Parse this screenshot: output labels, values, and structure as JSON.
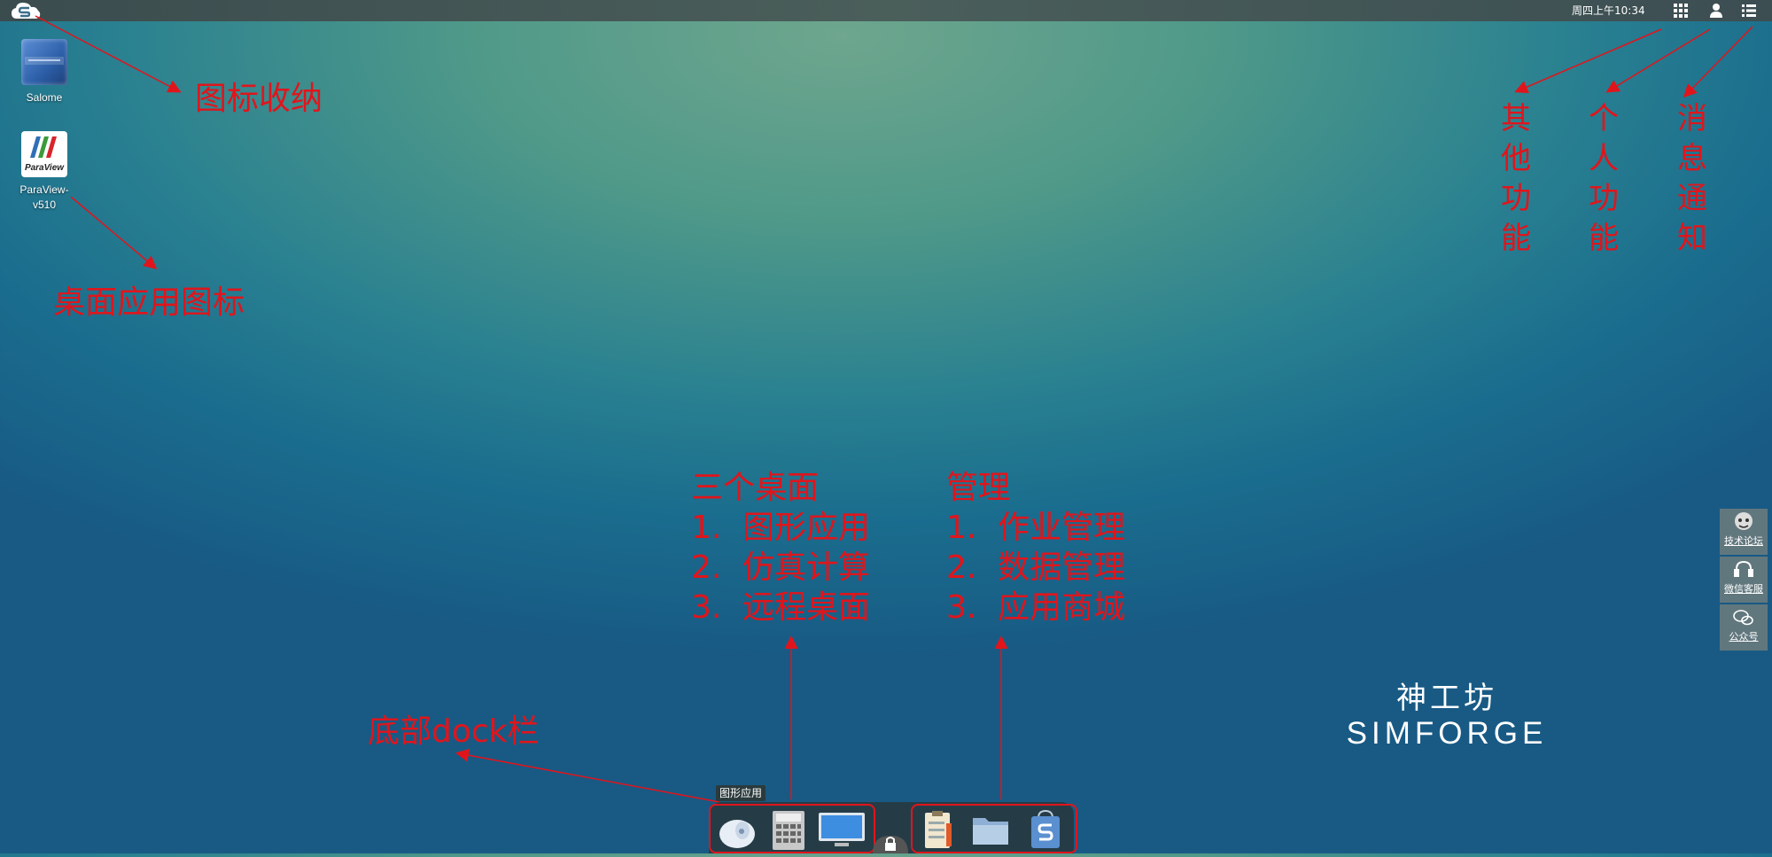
{
  "topbar": {
    "clock": "周四上午10:34",
    "icons": [
      "apps-grid-icon",
      "user-icon",
      "list-menu-icon"
    ]
  },
  "desktop_icons": [
    {
      "label_line1": "Salome",
      "label_line2": ""
    },
    {
      "label_line1": "ParaView-",
      "label_line2": "v510",
      "logo_text": "ParaView"
    }
  ],
  "annotations": {
    "icon_collapse": "图标收纳",
    "desktop_app_icons": "桌面应用图标",
    "other_functions": [
      "其",
      "他",
      "功",
      "能"
    ],
    "personal_functions": [
      "个",
      "人",
      "功",
      "能"
    ],
    "message_notice": [
      "消",
      "息",
      "通",
      "知"
    ],
    "dock_bar": "底部dock栏",
    "three_desktops": {
      "title": "三个桌面",
      "items": [
        {
          "num": "1.",
          "text": "图形应用"
        },
        {
          "num": "2.",
          "text": "仿真计算"
        },
        {
          "num": "3.",
          "text": "远程桌面"
        }
      ]
    },
    "management": {
      "title": "管理",
      "items": [
        {
          "num": "1.",
          "text": "作业管理"
        },
        {
          "num": "2.",
          "text": "数据管理"
        },
        {
          "num": "3.",
          "text": "应用商城"
        }
      ]
    }
  },
  "side_buttons": [
    {
      "label": "技术论坛",
      "icon": "forum-avatar-icon"
    },
    {
      "label": "微信客服",
      "icon": "headset-icon"
    },
    {
      "label": "公众号",
      "icon": "wechat-icon"
    }
  ],
  "brand": {
    "cn": "神工坊",
    "en": "SIMFORGE"
  },
  "dock": {
    "tooltip": "图形应用",
    "left_items": [
      "graphics-app-icon",
      "calculator-icon",
      "monitor-icon"
    ],
    "center_item": "lock-icon",
    "right_items": [
      "job-clipboard-icon",
      "folder-icon",
      "store-icon"
    ]
  },
  "colors": {
    "annotation": "#e0151c",
    "topbar": "#3f5254"
  }
}
